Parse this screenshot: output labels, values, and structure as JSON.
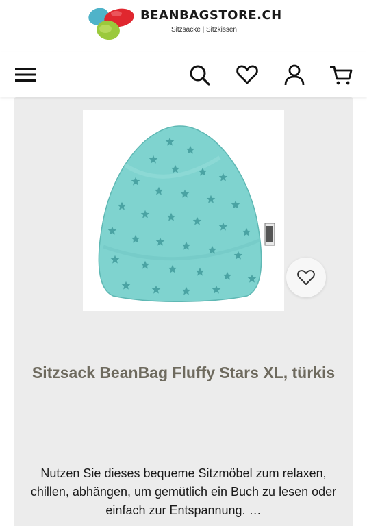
{
  "header": {
    "brand": "BEANBAGSTORE.CH",
    "tagline": "Sitzsäcke  |  Sitzkissen",
    "logo_icon": "beanbag-cluster-logo"
  },
  "nav": {
    "menu_icon": "hamburger-menu-icon",
    "search_icon": "search-icon",
    "wishlist_icon": "heart-icon",
    "account_icon": "user-icon",
    "cart_icon": "cart-icon"
  },
  "product": {
    "title": "Sitzsack BeanBag Fluffy Stars XL, türkis",
    "description": "Nutzen Sie dieses bequeme Sitzmöbel zum relaxen, chillen, abhängen, um gemütlich ein Buch zu lesen oder einfach zur Entspannung. …",
    "wishlist_icon": "heart-outline-icon",
    "label_tag_text": "SITTING POINT",
    "colors": {
      "bag": "#7fd3cf",
      "stars": "#4aa3a3",
      "title": "#6e6a5e"
    }
  }
}
